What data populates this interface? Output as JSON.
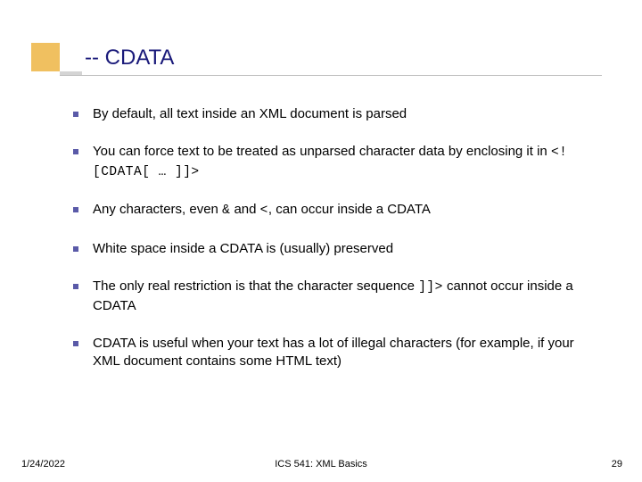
{
  "title": "-- CDATA",
  "bullets": [
    {
      "pre": "By default, all text inside an XML document is parsed",
      "code": "",
      "post": ""
    },
    {
      "pre": "You can force text to be treated as unparsed character data by enclosing it in ",
      "code": "<![CDATA[ … ]]>",
      "post": ""
    },
    {
      "pre": "Any characters, even ",
      "code": "&",
      "mid": " and ",
      "code2": "<",
      "post": ", can occur inside a CDATA"
    },
    {
      "pre": "White space inside a CDATA is (usually) preserved",
      "code": "",
      "post": ""
    },
    {
      "pre": "The only real restriction is that the character sequence ",
      "code": "]]>",
      "post": " cannot occur inside a CDATA"
    },
    {
      "pre": "CDATA is useful when your text has a lot of illegal characters (for example, if your XML document contains some HTML text)",
      "code": "",
      "post": ""
    }
  ],
  "footer": {
    "date": "1/24/2022",
    "center": "ICS 541: XML Basics",
    "page": "29"
  }
}
